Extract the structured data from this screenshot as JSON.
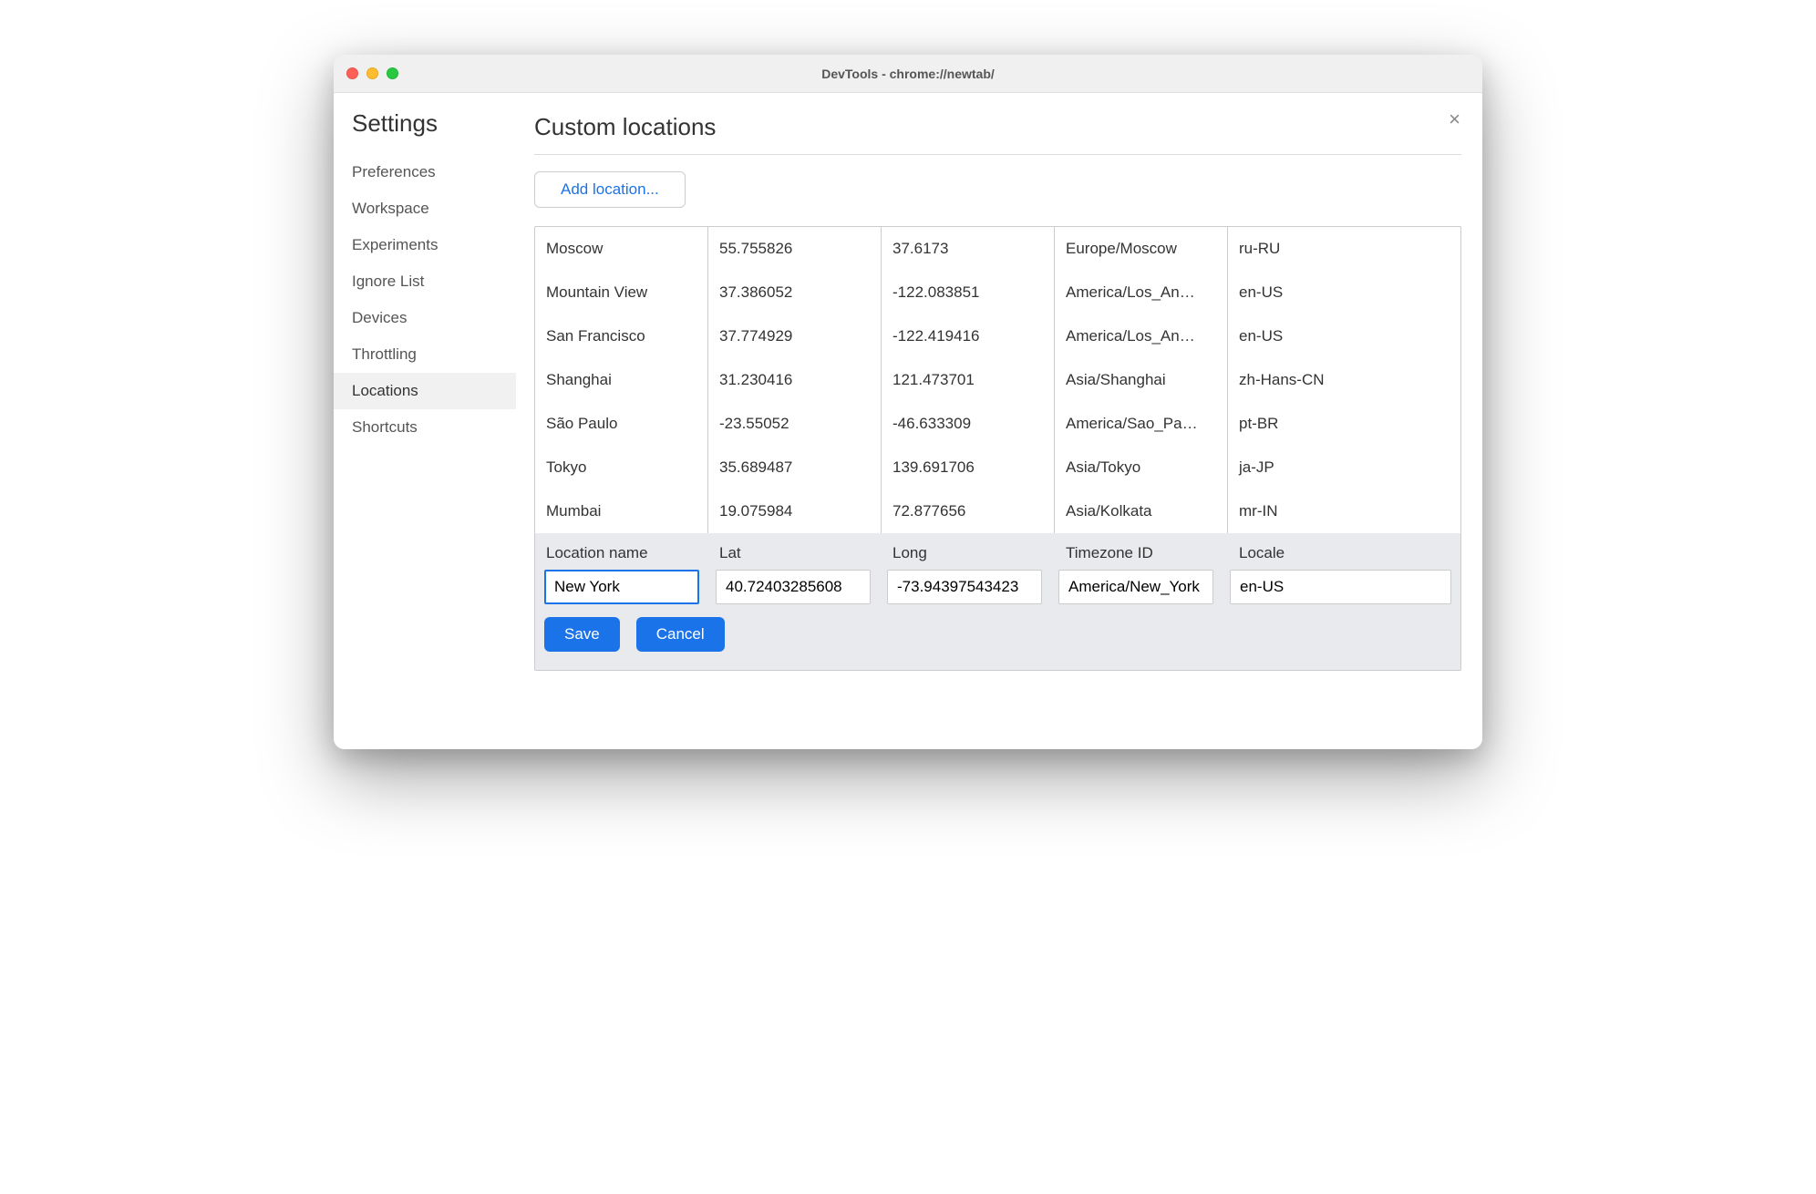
{
  "window_title": "DevTools - chrome://newtab/",
  "sidebar": {
    "title": "Settings",
    "items": [
      {
        "label": "Preferences",
        "active": false
      },
      {
        "label": "Workspace",
        "active": false
      },
      {
        "label": "Experiments",
        "active": false
      },
      {
        "label": "Ignore List",
        "active": false
      },
      {
        "label": "Devices",
        "active": false
      },
      {
        "label": "Throttling",
        "active": false
      },
      {
        "label": "Locations",
        "active": true
      },
      {
        "label": "Shortcuts",
        "active": false
      }
    ]
  },
  "main": {
    "title": "Custom locations",
    "add_button": "Add location...",
    "close_char": "×",
    "rows": [
      {
        "name": "Moscow",
        "lat": "55.755826",
        "long": "37.6173",
        "tz": "Europe/Moscow",
        "locale": "ru-RU"
      },
      {
        "name": "Mountain View",
        "lat": "37.386052",
        "long": "-122.083851",
        "tz": "America/Los_An…",
        "locale": "en-US"
      },
      {
        "name": "San Francisco",
        "lat": "37.774929",
        "long": "-122.419416",
        "tz": "America/Los_An…",
        "locale": "en-US"
      },
      {
        "name": "Shanghai",
        "lat": "31.230416",
        "long": "121.473701",
        "tz": "Asia/Shanghai",
        "locale": "zh-Hans-CN"
      },
      {
        "name": "São Paulo",
        "lat": "-23.55052",
        "long": "-46.633309",
        "tz": "America/Sao_Pa…",
        "locale": "pt-BR"
      },
      {
        "name": "Tokyo",
        "lat": "35.689487",
        "long": "139.691706",
        "tz": "Asia/Tokyo",
        "locale": "ja-JP"
      },
      {
        "name": "Mumbai",
        "lat": "19.075984",
        "long": "72.877656",
        "tz": "Asia/Kolkata",
        "locale": "mr-IN"
      }
    ],
    "editor": {
      "labels": {
        "name": "Location name",
        "lat": "Lat",
        "long": "Long",
        "tz": "Timezone ID",
        "locale": "Locale"
      },
      "values": {
        "name": "New York",
        "lat": "40.72403285608",
        "long": "-73.94397543423",
        "tz": "America/New_York",
        "locale": "en-US"
      },
      "save_label": "Save",
      "cancel_label": "Cancel"
    }
  }
}
